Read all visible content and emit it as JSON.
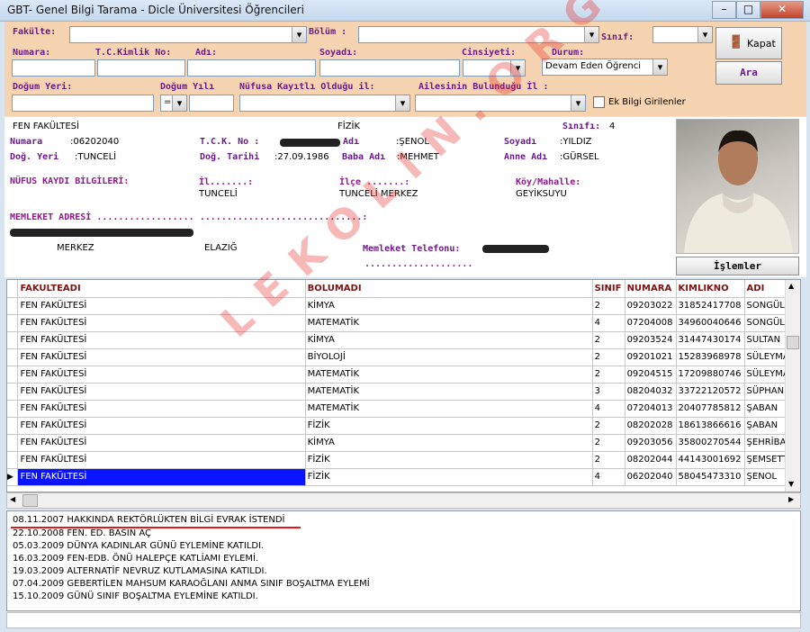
{
  "window": {
    "title": "GBT- Genel Bilgi Tarama - Dicle Üniversitesi Öğrencileri",
    "minimize": "–",
    "maximize": "□",
    "close": "✕"
  },
  "filters": {
    "fakulte_label": "Fakülte:",
    "bolum_label": "Bölüm :",
    "sinif_label": "Sınıf:",
    "numara_label": "Numara:",
    "tckimlik_label": "T.C.Kimlik No:",
    "adi_label": "Adı:",
    "soyadi_label": "Soyadı:",
    "cinsiyet_label": "Cinsiyeti:",
    "durum_label": "Durum:",
    "durum_value": "Devam Eden Öğrenci",
    "dogum_yeri_label": "Doğum Yeri:",
    "dogum_yili_label": "Doğum Yılı",
    "nufus_label": "Nüfusa Kayıtlı Olduğu il:",
    "aile_label": "Ailesinin Bulunduğu İl :",
    "operator_value": "=",
    "ek_bilgi_label": "Ek Bilgi Girilenler",
    "kapat_label": "Kapat",
    "ara_label": "Ara"
  },
  "info": {
    "fakulte": "FEN FAKÜLTESİ",
    "bolum": "FİZİK",
    "sinif_label": "Sınıfı:",
    "sinif": "4",
    "numara_label": "Numara",
    "numara": ":06202040",
    "tck_label": "T.C.K. No :",
    "adi_label": "Adı",
    "adi": ":ŞENOL",
    "soyadi_label": "Soyadı",
    "soyadi": ":YILDIZ",
    "dogum_yeri_label": "Doğ. Yeri",
    "dogum_yeri": ":TUNCELİ",
    "dogum_tarihi_label": "Doğ. Tarihi",
    "dogum_tarihi": ":27.09.1986",
    "baba_label": "Baba Adı",
    "baba": ":MEHMET",
    "anne_label": "Anne Adı",
    "anne": ":GÜRSEL",
    "nufus_title": "NÜFUS KAYDI BİLGİLERİ:",
    "il_label": "İl.......:",
    "il": "TUNCELİ",
    "ilce_label": "İlçe .......:",
    "ilce": "TUNCELİ MERKEZ",
    "koy_label": "Köy/Mahalle:",
    "koy": "GEYİKSUYU",
    "adres_title": "MEMLEKET ADRESİ  .................. ..............................:",
    "adres_merkez": "MERKEZ",
    "adres_il": "ELAZIĞ",
    "telefon_label": "Memleket Telefonu:",
    "telefon_dots": "....................",
    "islemler_label": "İşlemler"
  },
  "table": {
    "columns": [
      "FAKULTEADI",
      "BOLUMADI",
      "SINIF",
      "NUMARA",
      "KIMLIKNO",
      "ADI"
    ],
    "rows": [
      [
        "FEN FAKÜLTESİ",
        "KİMYA",
        "2",
        "09203022",
        "31852417708",
        "SONGÜL"
      ],
      [
        "FEN FAKÜLTESİ",
        "MATEMATİK",
        "4",
        "07204008",
        "34960040646",
        "SONGÜL"
      ],
      [
        "FEN FAKÜLTESİ",
        "KİMYA",
        "2",
        "09203524",
        "31447430174",
        "SULTAN"
      ],
      [
        "FEN FAKÜLTESİ",
        "BİYOLOJİ",
        "2",
        "09201021",
        "15283968978",
        "SÜLEYMAN"
      ],
      [
        "FEN FAKÜLTESİ",
        "MATEMATİK",
        "2",
        "09204515",
        "17209880746",
        "SÜLEYMAN"
      ],
      [
        "FEN FAKÜLTESİ",
        "MATEMATİK",
        "3",
        "08204032",
        "33722120572",
        "SÜPHAN"
      ],
      [
        "FEN FAKÜLTESİ",
        "MATEMATİK",
        "4",
        "07204013",
        "20407785812",
        "ŞABAN"
      ],
      [
        "FEN FAKÜLTESİ",
        "FİZİK",
        "2",
        "08202028",
        "18613866616",
        "ŞABAN"
      ],
      [
        "FEN FAKÜLTESİ",
        "KİMYA",
        "2",
        "09203056",
        "35800270544",
        "ŞEHRİBAN"
      ],
      [
        "FEN FAKÜLTESİ",
        "FİZİK",
        "2",
        "08202044",
        "44143001692",
        "ŞEMSETTİN"
      ],
      [
        "FEN FAKÜLTESİ",
        "FİZİK",
        "4",
        "06202040",
        "58045473310",
        "ŞENOL"
      ]
    ]
  },
  "notes": [
    "08.11.2007 HAKKINDA REKTÖRLÜKTEN BİLGİ EVRAK İSTENDİ",
    "22.10.2008 FEN. ED. BASIN AÇ",
    "05.03.2009 DÜNYA KADINLAR GÜNÜ EYLEMİNE KATILDI.",
    "16.03.2009 FEN-EDB. ÖNÜ HALEPÇE KATLİAMI EYLEMİ.",
    "19.03.2009 ALTERNATİF NEVRUZ KUTLAMASINA KATILDI.",
    "07.04.2009 GEBERTİLEN MAHSUM KARAOĞLANI ANMA SINIF BOŞALTMA EYLEMİ",
    "15.10.2009 GÜNÜ SINIF BOŞALTMA EYLEMİNE KATILDI."
  ],
  "watermark": "LEKOLIN.ORG",
  "colors": {
    "filter_bg": "#f6d4b1",
    "label": "#6b1a8a",
    "header": "#7a1212",
    "selection": "#0a14ff",
    "watermark": "#e82828"
  }
}
